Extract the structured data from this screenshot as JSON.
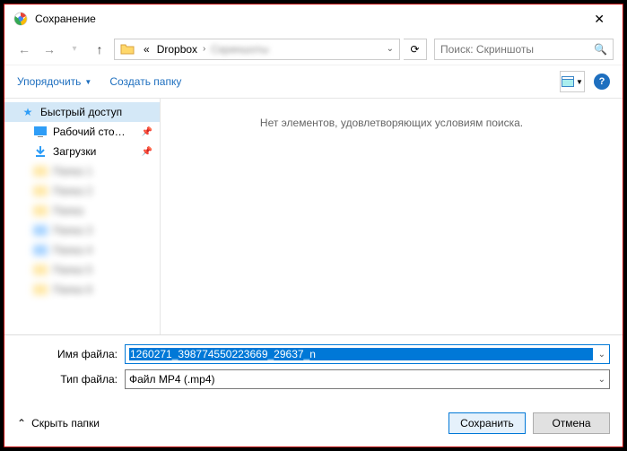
{
  "title": "Сохранение",
  "close": "✕",
  "nav": {
    "back": "←",
    "forward": "→",
    "up": "↑"
  },
  "breadcrumb": {
    "prefix": "«",
    "item1": "Dropbox",
    "sep": "›",
    "item2": "Скриншоты"
  },
  "refresh": "⟳",
  "search": {
    "placeholder": "Поиск: Скриншоты"
  },
  "toolbar": {
    "organize": "Упорядочить",
    "newfolder": "Создать папку"
  },
  "sidebar": {
    "quickaccess": "Быстрый доступ",
    "desktop": "Рабочий сто…",
    "downloads": "Загрузки"
  },
  "content": {
    "empty": "Нет элементов, удовлетворяющих условиям поиска."
  },
  "fields": {
    "filename_label": "Имя файла:",
    "filename_value": "1260271_398774550223669_29637_n",
    "filetype_label": "Тип файла:",
    "filetype_value": "Файл MP4 (.mp4)"
  },
  "footer": {
    "hidefolders": "Скрыть папки",
    "save": "Сохранить",
    "cancel": "Отмена"
  },
  "help": "?"
}
